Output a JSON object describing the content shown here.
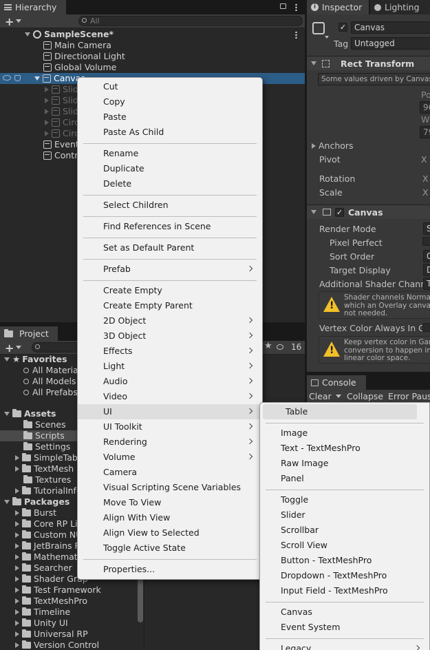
{
  "hierarchy": {
    "tab": "Hierarchy",
    "search_placeholder": "All",
    "scene": "SampleScene*",
    "items": [
      "Main Camera",
      "Directional Light",
      "Global Volume",
      "Canvas"
    ],
    "canvas_children": [
      "Slid",
      "Slid",
      "Slid",
      "Circ",
      "Circ"
    ],
    "after": [
      "Event",
      "Contr"
    ]
  },
  "inspector": {
    "tab": "Inspector",
    "lighting_tab": "Lighting",
    "object_name": "Canvas",
    "tag_label": "Tag",
    "tag_value": "Untagged",
    "rect_transform": "Rect Transform",
    "driven_note": "Some values driven by Canvas.",
    "pos_label": "Po",
    "pos_value": "96",
    "w_label": "W",
    "w_value": "79",
    "anchors": "Anchors",
    "pivot": "Pivot",
    "rotation": "Rotation",
    "scale": "Scale",
    "x_label": "X",
    "canvas_section": "Canvas",
    "render_mode": "Render Mode",
    "render_mode_value": "S",
    "pixel_perfect": "Pixel Perfect",
    "sort_order": "Sort Order",
    "sort_order_value": "0",
    "target_display": "Target Display",
    "target_display_value": "D",
    "additional_shader": "Additional Shader Channel",
    "additional_shader_value": "T",
    "warn1": "Shader channels Normal a\nwhich an Overlay canvas\nnot needed.",
    "vertex_color": "Vertex Color Always In Gar",
    "warn2": "Keep vertex color in Gamm\nconversion to happen in U\nlinear color space."
  },
  "project": {
    "tab": "Project",
    "count": "16",
    "favorites": "Favorites",
    "fav_items": [
      "All Material",
      "All Models",
      "All Prefabs"
    ],
    "assets": "Assets",
    "asset_items": [
      "Scenes",
      "Scripts",
      "Settings",
      "SimpleTabl",
      "TextMesh F",
      "Textures",
      "TutorialInfo"
    ],
    "packages": "Packages",
    "package_items": [
      "Burst",
      "Core RP Lit",
      "Custom NU",
      "JetBrains R",
      "Mathemati",
      "Searcher",
      "Shader Grap",
      "Test Framework",
      "TextMeshPro",
      "Timeline",
      "Unity UI",
      "Universal RP",
      "Version Control"
    ]
  },
  "console": {
    "tab": "Console",
    "clear": "Clear",
    "collapse": "Collapse",
    "error_pause": "Error Pause"
  },
  "context_menu": {
    "groups": [
      [
        "Cut",
        "Copy",
        "Paste",
        "Paste As Child"
      ],
      [
        "Rename",
        "Duplicate",
        "Delete"
      ],
      [
        "Select Children"
      ],
      [
        "Find References in Scene"
      ],
      [
        "Set as Default Parent"
      ],
      [
        "Prefab"
      ],
      [
        "Create Empty",
        "Create Empty Parent",
        "2D Object",
        "3D Object",
        "Effects",
        "Light",
        "Audio",
        "Video",
        "UI",
        "UI Toolkit",
        "Rendering",
        "Volume",
        "Camera",
        "Visual Scripting Scene Variables",
        "Move To View",
        "Align With View",
        "Align View to Selected",
        "Toggle Active State"
      ],
      [
        "Properties..."
      ]
    ]
  },
  "ui_submenu": {
    "groups": [
      [
        "Table"
      ],
      [
        "Image",
        "Text - TextMeshPro",
        "Raw Image",
        "Panel"
      ],
      [
        "Toggle",
        "Slider",
        "Scrollbar",
        "Scroll View",
        "Button - TextMeshPro",
        "Dropdown - TextMeshPro",
        "Input Field - TextMeshPro"
      ],
      [
        "Canvas",
        "Event System"
      ],
      [
        "Legacy"
      ]
    ]
  }
}
